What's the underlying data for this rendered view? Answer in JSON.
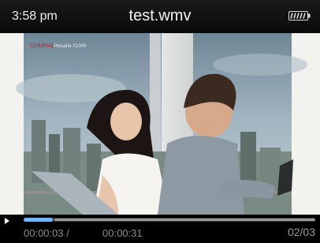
{
  "status_bar": {
    "time": "3:58 pm",
    "title": "test.wmv",
    "battery_icon": "battery-full-icon"
  },
  "video": {
    "overlay_logo": "COMPAQ",
    "overlay_model": "Presario X1000"
  },
  "playback": {
    "elapsed": "00:00:03 /",
    "duration": "00:00:31",
    "progress": 0.1,
    "counter": "02/03"
  },
  "colors": {
    "progress_fill": "#6fb6ff",
    "background": "#000000",
    "logo_red": "#d21a1a"
  }
}
